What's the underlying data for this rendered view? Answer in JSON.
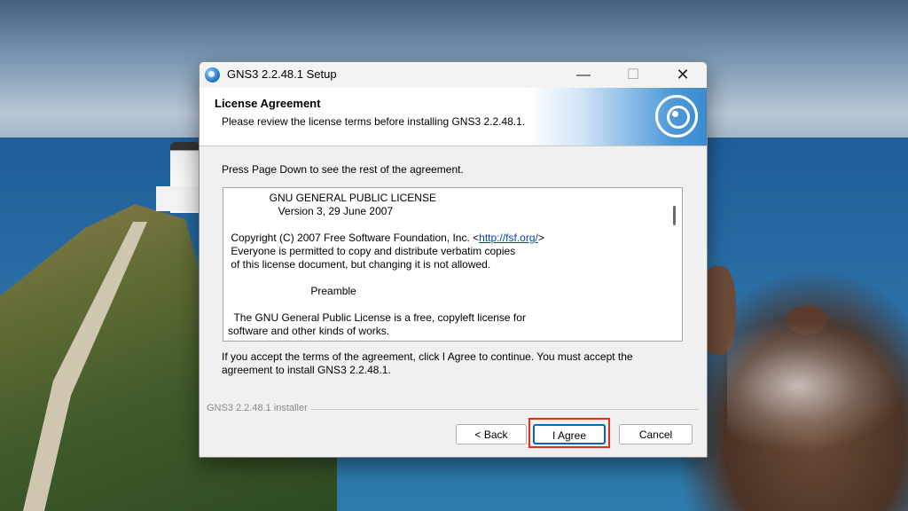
{
  "window": {
    "title": "GNS3 2.2.48.1 Setup",
    "controls": {
      "minimize": "—",
      "maximize": "☐",
      "close": "✕"
    }
  },
  "header": {
    "title": "License Agreement",
    "subtitle": "Please review the license terms before installing GNS3 2.2.48.1.",
    "logo_icon": "gns3-chameleon-icon"
  },
  "body": {
    "instruction": "Press Page Down to see the rest of the agreement.",
    "license": {
      "line1": "              GNU GENERAL PUBLIC LICENSE",
      "line2": "                 Version 3, 29 June 2007",
      "line3_prefix": " Copyright (C) 2007 Free Software Foundation, Inc. <",
      "line3_link": "http://fsf.org/",
      "line3_suffix": ">",
      "line4": " Everyone is permitted to copy and distribute verbatim copies",
      "line5": " of this license document, but changing it is not allowed.",
      "line6": "                            Preamble",
      "line7": "  The GNU General Public License is a free, copyleft license for",
      "line8": "software and other kinds of works."
    },
    "accept_text": "If you accept the terms of the agreement, click I Agree to continue. You must accept the agreement to install GNS3 2.2.48.1."
  },
  "footer": {
    "installer_label": "GNS3 2.2.48.1 installer",
    "back_label": "< Back",
    "agree_label": "I Agree",
    "cancel_label": "Cancel"
  },
  "colors": {
    "highlight": "#e0311f",
    "accent": "#0067c0"
  }
}
